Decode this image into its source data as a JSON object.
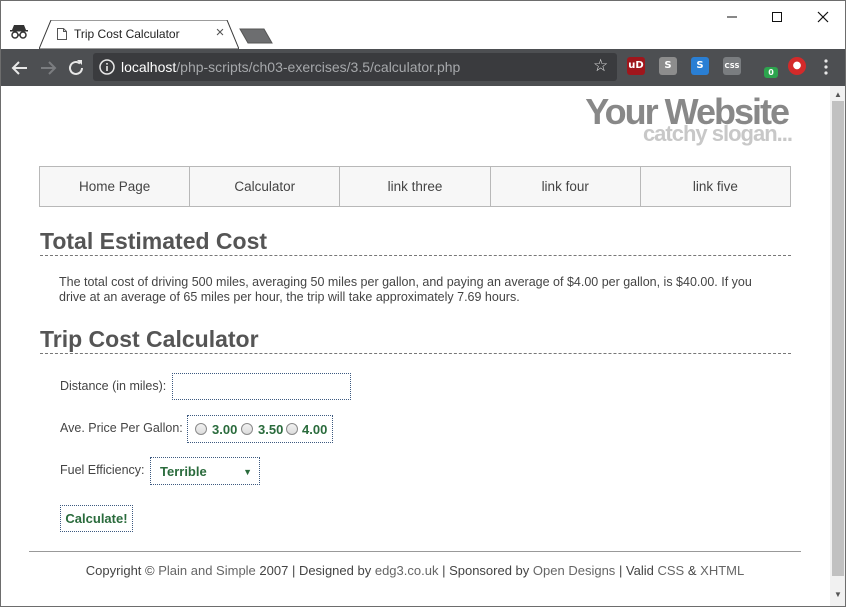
{
  "browser": {
    "tab_title": "Trip Cost Calculator",
    "tab_close": "×",
    "url_host": "localhost",
    "url_path": "/php-scripts/ch03-exercises/3.5/calculator.php",
    "window_controls": {
      "minimize": "—",
      "maximize": "☐",
      "close": "✕"
    },
    "extensions": [
      {
        "name": "ublock-icon",
        "label": "uD",
        "color": "#a0161c"
      },
      {
        "name": "s-extension-gray-icon",
        "label": "S",
        "color": "#8d8d8d"
      },
      {
        "name": "s-extension-blue-icon",
        "label": "S",
        "color": "#2a7fd4"
      },
      {
        "name": "css-extension-icon",
        "label": "CSS",
        "color": "#7a7d80"
      },
      {
        "name": "extension-badge-icon",
        "label": "0",
        "color": "#2da44e"
      },
      {
        "name": "red-extension-icon",
        "label": "●",
        "color": "#d42a2a"
      }
    ]
  },
  "site": {
    "brand_name": "Your Website",
    "slogan": "catchy slogan...",
    "nav": [
      "Home Page",
      "Calculator",
      "link three",
      "link four",
      "link five"
    ]
  },
  "result": {
    "heading": "Total Estimated Cost",
    "text": "The total cost of driving 500 miles, averaging 50 miles per gallon, and paying an average of $4.00 per gallon, is $40.00. If you drive at an average of 65 miles per hour, the trip will take approximately 7.69 hours."
  },
  "form": {
    "heading": "Trip Cost Calculator",
    "distance_label": "Distance (in miles):",
    "distance_value": "",
    "price_label": "Ave. Price Per Gallon:",
    "price_options": [
      "3.00",
      "3.50",
      "4.00"
    ],
    "efficiency_label": "Fuel Efficiency:",
    "efficiency_value": "Terrible",
    "submit_label": "Calculate!"
  },
  "footer": {
    "copyright": "Copyright ©",
    "plain_simple": "Plain and Simple",
    "year_designed": "2007 | Designed by",
    "designer": "edg3.co.uk",
    "sponsored": "| Sponsored by",
    "sponsor": "Open Designs",
    "valid": "| Valid",
    "css": "CSS",
    "amp": "&",
    "xhtml": "XHTML"
  }
}
